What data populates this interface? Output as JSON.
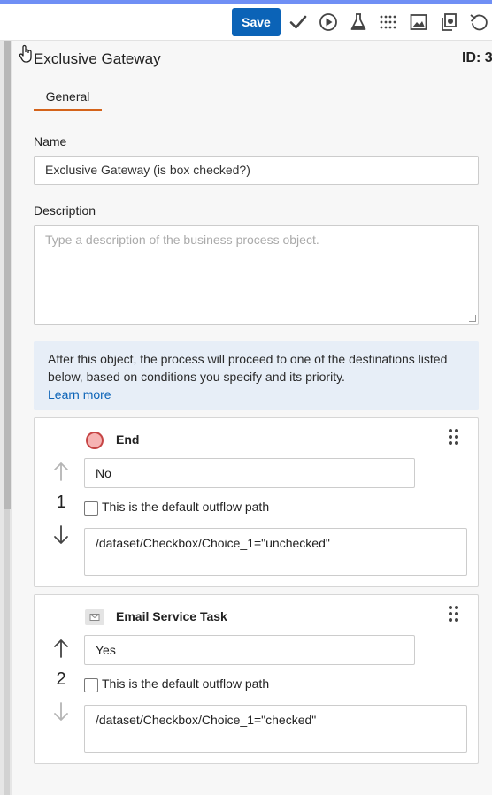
{
  "toolbar": {
    "save_label": "Save",
    "icons": [
      "check-icon",
      "play-icon",
      "flask-icon",
      "grid-dots-icon",
      "image-icon",
      "copy-icon",
      "undo-icon"
    ]
  },
  "header": {
    "title": "Exclusive Gateway",
    "id_label": "ID: 3"
  },
  "tabs": [
    {
      "label": "General",
      "active": true
    }
  ],
  "form": {
    "name_label": "Name",
    "name_value": "Exclusive Gateway (is box checked?)",
    "description_label": "Description",
    "description_placeholder": "Type a description of the business process object."
  },
  "info": {
    "text": "After this object, the process will proceed to one of the destinations listed below, based on conditions you specify and its priority.",
    "link": "Learn more"
  },
  "flows": [
    {
      "target": "End",
      "target_icon": "end-event-circle-icon",
      "condition_name": "No",
      "priority": "1",
      "default_label": "This is the default outflow path",
      "default_checked": false,
      "expression": "/dataset/Checkbox/Choice_1=\"unchecked\""
    },
    {
      "target": "Email Service Task",
      "target_icon": "email-icon",
      "condition_name": "Yes",
      "priority": "2",
      "default_label": "This is the default outflow path",
      "default_checked": false,
      "expression": "/dataset/Checkbox/Choice_1=\"checked\""
    }
  ],
  "colors": {
    "accent": "#0b63b7",
    "tab_underline": "#d4631a",
    "info_bg": "#e7eef7",
    "end_fill": "#f6b3b3",
    "end_stroke": "#c64545"
  }
}
